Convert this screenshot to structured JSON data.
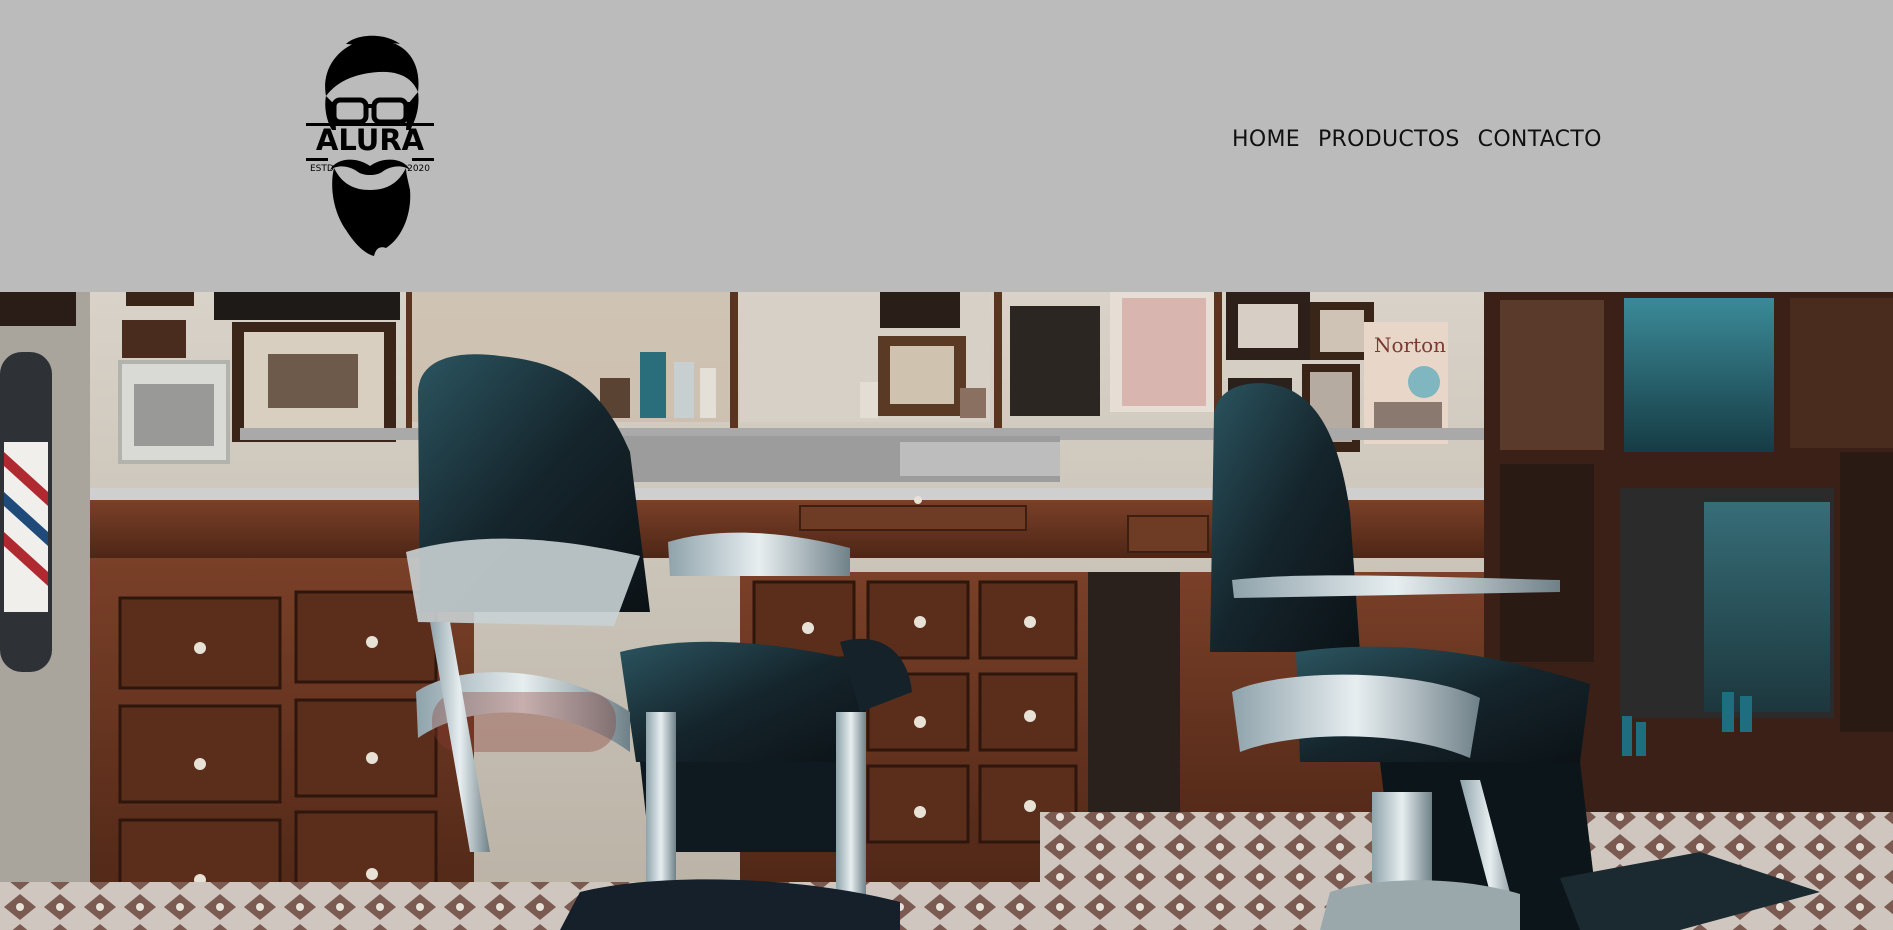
{
  "logo": {
    "brand": "ALURA",
    "estd": "ESTD",
    "year": "2020",
    "icon": "bearded-man-logo-icon"
  },
  "nav": {
    "items": [
      {
        "label": "HOME"
      },
      {
        "label": "PRODUCTOS"
      },
      {
        "label": "CONTACTO"
      }
    ]
  },
  "hero": {
    "image": "barbershop-interior-photo",
    "sign_text": "Norton"
  },
  "colors": {
    "header_bg": "#bbbbbb",
    "nav_text": "#111111",
    "wood": "#6b3a24",
    "leather": "#1d2a30"
  }
}
